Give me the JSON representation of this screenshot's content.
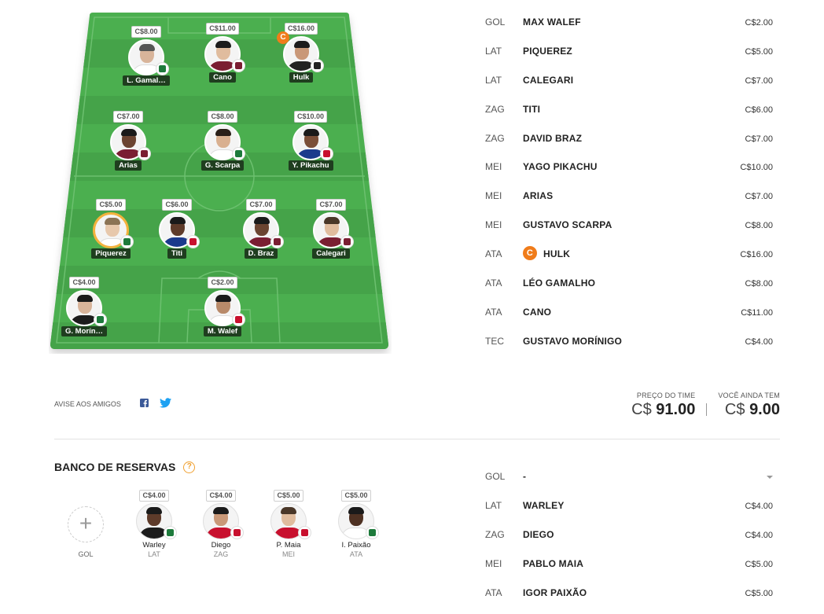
{
  "field": {
    "players": [
      {
        "name": "L. Gamal…",
        "price": "C$8.00",
        "captain": false,
        "selected": false,
        "skin": "#d8b49a",
        "hair": "#555",
        "shirt": "#ffffff",
        "club": "#1d7a3b"
      },
      {
        "name": "Cano",
        "price": "C$11.00",
        "captain": false,
        "selected": false,
        "skin": "#e0bc9e",
        "hair": "#1c1c1c",
        "shirt": "#7a1e32",
        "club": "#7a1e32"
      },
      {
        "name": "Hulk",
        "price": "C$16.00",
        "captain": true,
        "selected": false,
        "skin": "#c99878",
        "hair": "#1c1c1c",
        "shirt": "#222222",
        "club": "#222222"
      },
      {
        "name": "Arias",
        "price": "C$7.00",
        "captain": false,
        "selected": false,
        "skin": "#6b4431",
        "hair": "#1a1a1a",
        "shirt": "#7a1e32",
        "club": "#7a1e32"
      },
      {
        "name": "G. Scarpa",
        "price": "C$8.00",
        "captain": false,
        "selected": false,
        "skin": "#d9b090",
        "hair": "#2a1f18",
        "shirt": "#ffffff",
        "club": "#1d7a3b"
      },
      {
        "name": "Y. Pikachu",
        "price": "C$10.00",
        "captain": false,
        "selected": false,
        "skin": "#7b4f38",
        "hair": "#1a1a1a",
        "shirt": "#1b3a8c",
        "club": "#c8102e"
      },
      {
        "name": "Piquerez",
        "price": "C$5.00",
        "captain": false,
        "selected": true,
        "skin": "#e7c8ac",
        "hair": "#8b7355",
        "shirt": "#ffffff",
        "club": "#1d7a3b"
      },
      {
        "name": "Titi",
        "price": "C$6.00",
        "captain": false,
        "selected": false,
        "skin": "#5e3b2a",
        "hair": "#1a1a1a",
        "shirt": "#1b3a8c",
        "club": "#c8102e"
      },
      {
        "name": "D. Braz",
        "price": "C$7.00",
        "captain": false,
        "selected": false,
        "skin": "#6b4431",
        "hair": "#1a1a1a",
        "shirt": "#7a1e32",
        "club": "#7a1e32"
      },
      {
        "name": "Calegari",
        "price": "C$7.00",
        "captain": false,
        "selected": false,
        "skin": "#e0bc9e",
        "hair": "#4a3728",
        "shirt": "#7a1e32",
        "club": "#7a1e32"
      },
      {
        "name": "G. Morín…",
        "price": "C$4.00",
        "captain": false,
        "selected": false,
        "skin": "#d8b49a",
        "hair": "#1a1a1a",
        "shirt": "#1c1c1c",
        "club": "#1d7a3b"
      },
      {
        "name": "M. Walef",
        "price": "C$2.00",
        "captain": false,
        "selected": false,
        "skin": "#b88a6a",
        "hair": "#1a1a1a",
        "shirt": "#ffffff",
        "club": "#c8102e"
      }
    ]
  },
  "lineup": [
    {
      "pos": "GOL",
      "name": "MAX WALEF",
      "price": "C$2.00",
      "captain": false
    },
    {
      "pos": "LAT",
      "name": "PIQUEREZ",
      "price": "C$5.00",
      "captain": false
    },
    {
      "pos": "LAT",
      "name": "CALEGARI",
      "price": "C$7.00",
      "captain": false
    },
    {
      "pos": "ZAG",
      "name": "TITI",
      "price": "C$6.00",
      "captain": false
    },
    {
      "pos": "ZAG",
      "name": "DAVID BRAZ",
      "price": "C$7.00",
      "captain": false
    },
    {
      "pos": "MEI",
      "name": "YAGO PIKACHU",
      "price": "C$10.00",
      "captain": false
    },
    {
      "pos": "MEI",
      "name": "ARIAS",
      "price": "C$7.00",
      "captain": false
    },
    {
      "pos": "MEI",
      "name": "GUSTAVO SCARPA",
      "price": "C$8.00",
      "captain": false
    },
    {
      "pos": "ATA",
      "name": "HULK",
      "price": "C$16.00",
      "captain": true
    },
    {
      "pos": "ATA",
      "name": "LÉO GAMALHO",
      "price": "C$8.00",
      "captain": false
    },
    {
      "pos": "ATA",
      "name": "CANO",
      "price": "C$11.00",
      "captain": false
    },
    {
      "pos": "TEC",
      "name": "GUSTAVO MORÍNIGO",
      "price": "C$4.00",
      "captain": false
    }
  ],
  "captain_letter": "C",
  "share": {
    "label": "AVISE AOS AMIGOS",
    "icons": [
      "facebook-icon",
      "twitter-icon"
    ]
  },
  "totals": {
    "team_price_label": "PREÇO DO TIME",
    "team_price_currency": "C$",
    "team_price_value": "91.00",
    "remaining_label": "VOCÊ AINDA TEM",
    "remaining_currency": "C$",
    "remaining_value": "9.00"
  },
  "bench": {
    "title": "BANCO DE RESERVAS",
    "help": "?",
    "add_symbol": "+",
    "add_label": "GOL",
    "players": [
      {
        "name": "Warley",
        "pos": "LAT",
        "price": "C$4.00",
        "skin": "#5e3b2a",
        "hair": "#1a1a1a",
        "shirt": "#1c1c1c",
        "club": "#1d7a3b"
      },
      {
        "name": "Diego",
        "pos": "ZAG",
        "price": "C$4.00",
        "skin": "#c99878",
        "hair": "#1a1a1a",
        "shirt": "#c8102e",
        "club": "#c8102e"
      },
      {
        "name": "P. Maia",
        "pos": "MEI",
        "price": "C$5.00",
        "skin": "#e0bc9e",
        "hair": "#4a3728",
        "shirt": "#c8102e",
        "club": "#c8102e"
      },
      {
        "name": "I. Paixão",
        "pos": "ATA",
        "price": "C$5.00",
        "skin": "#4e3122",
        "hair": "#1a1a1a",
        "shirt": "#ffffff",
        "club": "#1d7a3b"
      }
    ],
    "list": [
      {
        "pos": "GOL",
        "name": "-",
        "price": ""
      },
      {
        "pos": "LAT",
        "name": "WARLEY",
        "price": "C$4.00"
      },
      {
        "pos": "ZAG",
        "name": "DIEGO",
        "price": "C$4.00"
      },
      {
        "pos": "MEI",
        "name": "PABLO MAIA",
        "price": "C$5.00"
      },
      {
        "pos": "ATA",
        "name": "IGOR PAIXÃO",
        "price": "C$5.00"
      }
    ]
  },
  "colors": {
    "pitch": "#4caf50",
    "pitch_stripe": "#45a349",
    "captain": "#f07c1a",
    "name_tag": "#1f3e1f"
  }
}
